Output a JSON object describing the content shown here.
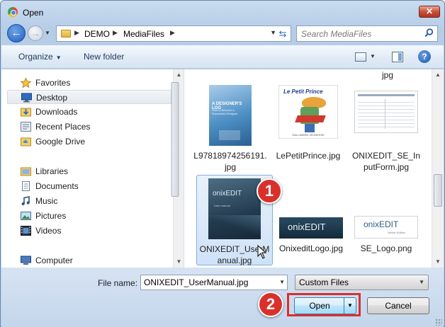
{
  "window": {
    "title": "Open",
    "close_label": "✕"
  },
  "address": {
    "breadcrumbs": [
      "DEMO",
      "MediaFiles"
    ],
    "search_placeholder": "Search MediaFiles"
  },
  "toolbar": {
    "organize_label": "Organize",
    "new_folder_label": "New folder",
    "help_label": "?"
  },
  "nav": {
    "favorites_label": "Favorites",
    "favorites": [
      "Desktop",
      "Downloads",
      "Recent Places",
      "Google Drive"
    ],
    "libraries_label": "Libraries",
    "libraries": [
      "Documents",
      "Music",
      "Pictures",
      "Videos"
    ],
    "computer_label": "Computer"
  },
  "files": {
    "partial_top_label": "jpg",
    "items": [
      {
        "name_line1": "L97818974256191.",
        "name_line2": "jpg",
        "thumb_title": "A DESIGNER'S LOG",
        "thumb_subtitle": "How to Become a Successful Designer"
      },
      {
        "name_line1": "LePetitPrince.jpg",
        "name_line2": "",
        "thumb_title": "Le Petit Prince",
        "thumb_subtitle": "GALLIMARD JEUNESSE"
      },
      {
        "name_line1": "ONIXEDIT_SE_In",
        "name_line2": "putForm.jpg"
      },
      {
        "name_line1": "ONIXEDIT_UserM",
        "name_line2": "anual.jpg",
        "thumb_brand": "onixEDIT",
        "thumb_sub": "User manual"
      },
      {
        "name_line1": "OnixeditLogo.jpg",
        "name_line2": "",
        "thumb_brand": "onixEDIT"
      },
      {
        "name_line1": "SE_Logo.png",
        "name_line2": "",
        "thumb_brand": "onixEDIT",
        "thumb_sub": "Server Edition"
      }
    ]
  },
  "bottom": {
    "file_name_label": "File name:",
    "file_name_value": "ONIXEDIT_UserManual.jpg",
    "filter_value": "Custom Files",
    "open_label": "Open",
    "cancel_label": "Cancel"
  },
  "annotations": {
    "step1": "1",
    "step2": "2",
    "accent_color": "#d9302c"
  }
}
